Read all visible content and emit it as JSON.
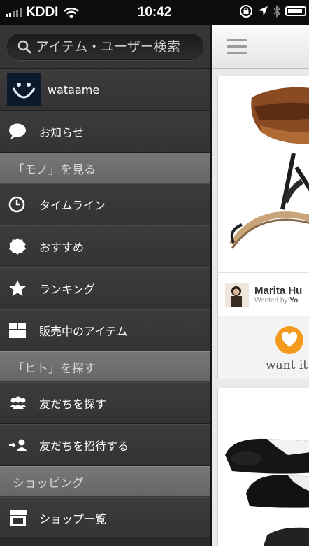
{
  "status_bar": {
    "carrier": "KDDI",
    "time": "10:42"
  },
  "menu": {
    "search_placeholder": "アイテム・ユーザー検索",
    "user": {
      "name": "wataame"
    },
    "notifications_label": "お知らせ",
    "sections": [
      {
        "title": "「モノ」を見る",
        "items": [
          {
            "label": "タイムライン",
            "icon": "clock-icon"
          },
          {
            "label": "おすすめ",
            "icon": "badge-icon"
          },
          {
            "label": "ランキング",
            "icon": "star-icon"
          },
          {
            "label": "販売中のアイテム",
            "icon": "box-icon"
          }
        ]
      },
      {
        "title": "「ヒト」を探す",
        "items": [
          {
            "label": "友だちを探す",
            "icon": "people-icon"
          },
          {
            "label": "友だちを招待する",
            "icon": "invite-icon"
          }
        ]
      },
      {
        "title": "ショッピング",
        "items": [
          {
            "label": "ショップ一覧",
            "icon": "shop-icon"
          }
        ]
      }
    ]
  },
  "feed": {
    "card1": {
      "owner_name": "Marita Hu",
      "wanted_by_prefix": "Wanted by:",
      "wanted_by_name": "Yo",
      "want_label": "want it"
    }
  },
  "colors": {
    "accent": "#f39a1f",
    "menu_bg": "#2c2c2c",
    "section_bg": "#6e6e6e"
  }
}
